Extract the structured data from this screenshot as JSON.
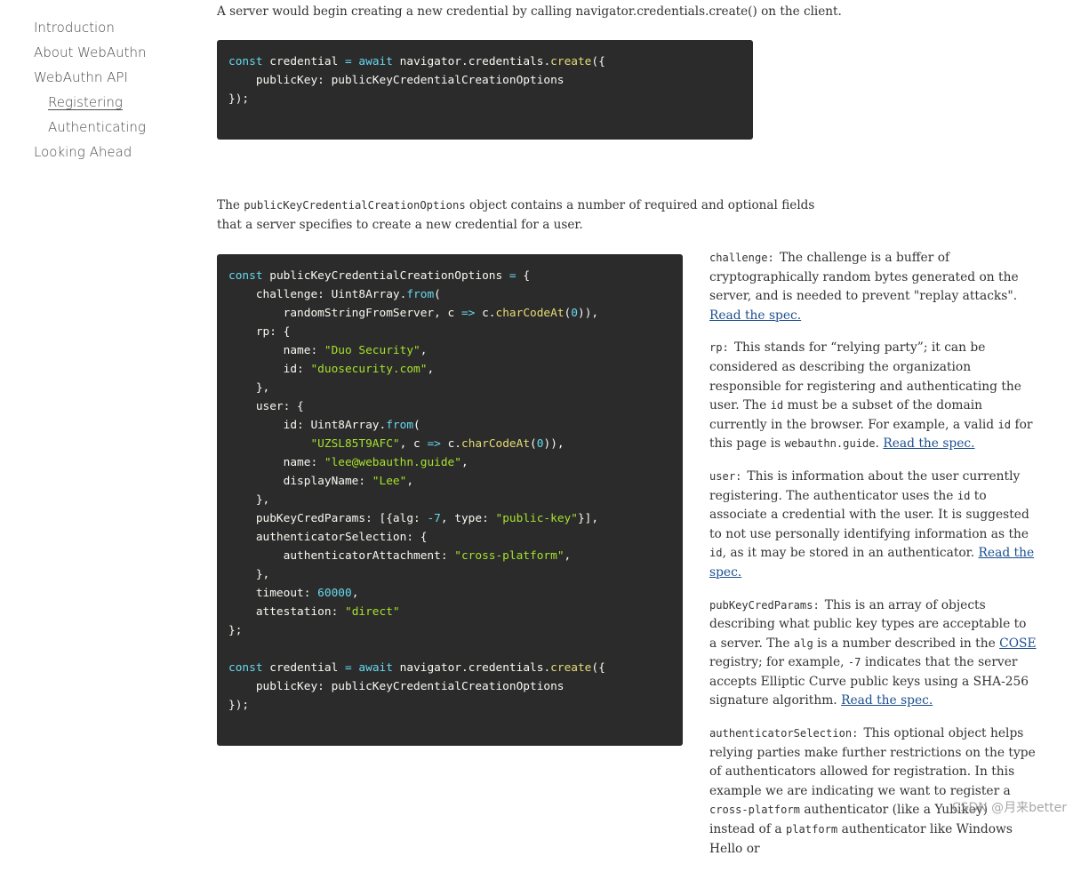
{
  "nav": {
    "items": [
      {
        "label": "Introduction"
      },
      {
        "label": "About WebAuthn"
      },
      {
        "label": "WebAuthn API"
      },
      {
        "label": "Registering"
      },
      {
        "label": "Authenticating"
      },
      {
        "label": "Looking Ahead"
      }
    ]
  },
  "intro": {
    "text": "A server would begin creating a new credential by calling navigator.credentials.create() on the client."
  },
  "para2": {
    "before": "The ",
    "code": "publicKeyCredentialCreationOptions",
    "after": " object contains a number of required and optional fields that a server specifies to create a new credential for a user."
  },
  "side": {
    "read_spec": "Read the spec.",
    "cose": "COSE",
    "challenge": {
      "term": "challenge:",
      "text": "The challenge is a buffer of cryptographically random bytes generated on the server, and is needed to prevent \"replay attacks\"."
    },
    "rp": {
      "term": "rp:",
      "t1": "This stands for “relying party”; it can be considered as describing the organization responsible for registering and authenticating the user. The ",
      "c1": "id",
      "t2": " must be a subset of the domain currently in the browser. For example, a valid ",
      "c2": "id",
      "t3": " for this page is ",
      "c3": "webauthn.guide",
      "t4": "."
    },
    "user": {
      "term": "user:",
      "t1": "This is information about the user currently registering. The authenticator uses the ",
      "c1": "id",
      "t2": " to associate a credential with the user. It is suggested to not use personally identifying information as the ",
      "c2": "id",
      "t3": ", as it may be stored in an authenticator."
    },
    "pubkey": {
      "term": "pubKeyCredParams:",
      "t1": "This is an array of objects describing what public key types are acceptable to a server. The ",
      "c1": "alg",
      "t2": " is a number described in the ",
      "t3": " registry; for example, ",
      "c2": "-7",
      "t4": " indicates that the server accepts Elliptic Curve public keys using a SHA-256 signature algorithm."
    },
    "auth": {
      "term": "authenticatorSelection:",
      "t1": "This optional object helps relying parties make further restrictions on the type of authenticators allowed for registration. In this example we are indicating we want to register a ",
      "c1": "cross-platform",
      "t2": " authenticator (like a Yubikey) instead of a ",
      "c2": "platform",
      "t3": " authenticator like Windows Hello or"
    }
  },
  "watermark": "CSDN @月来better"
}
